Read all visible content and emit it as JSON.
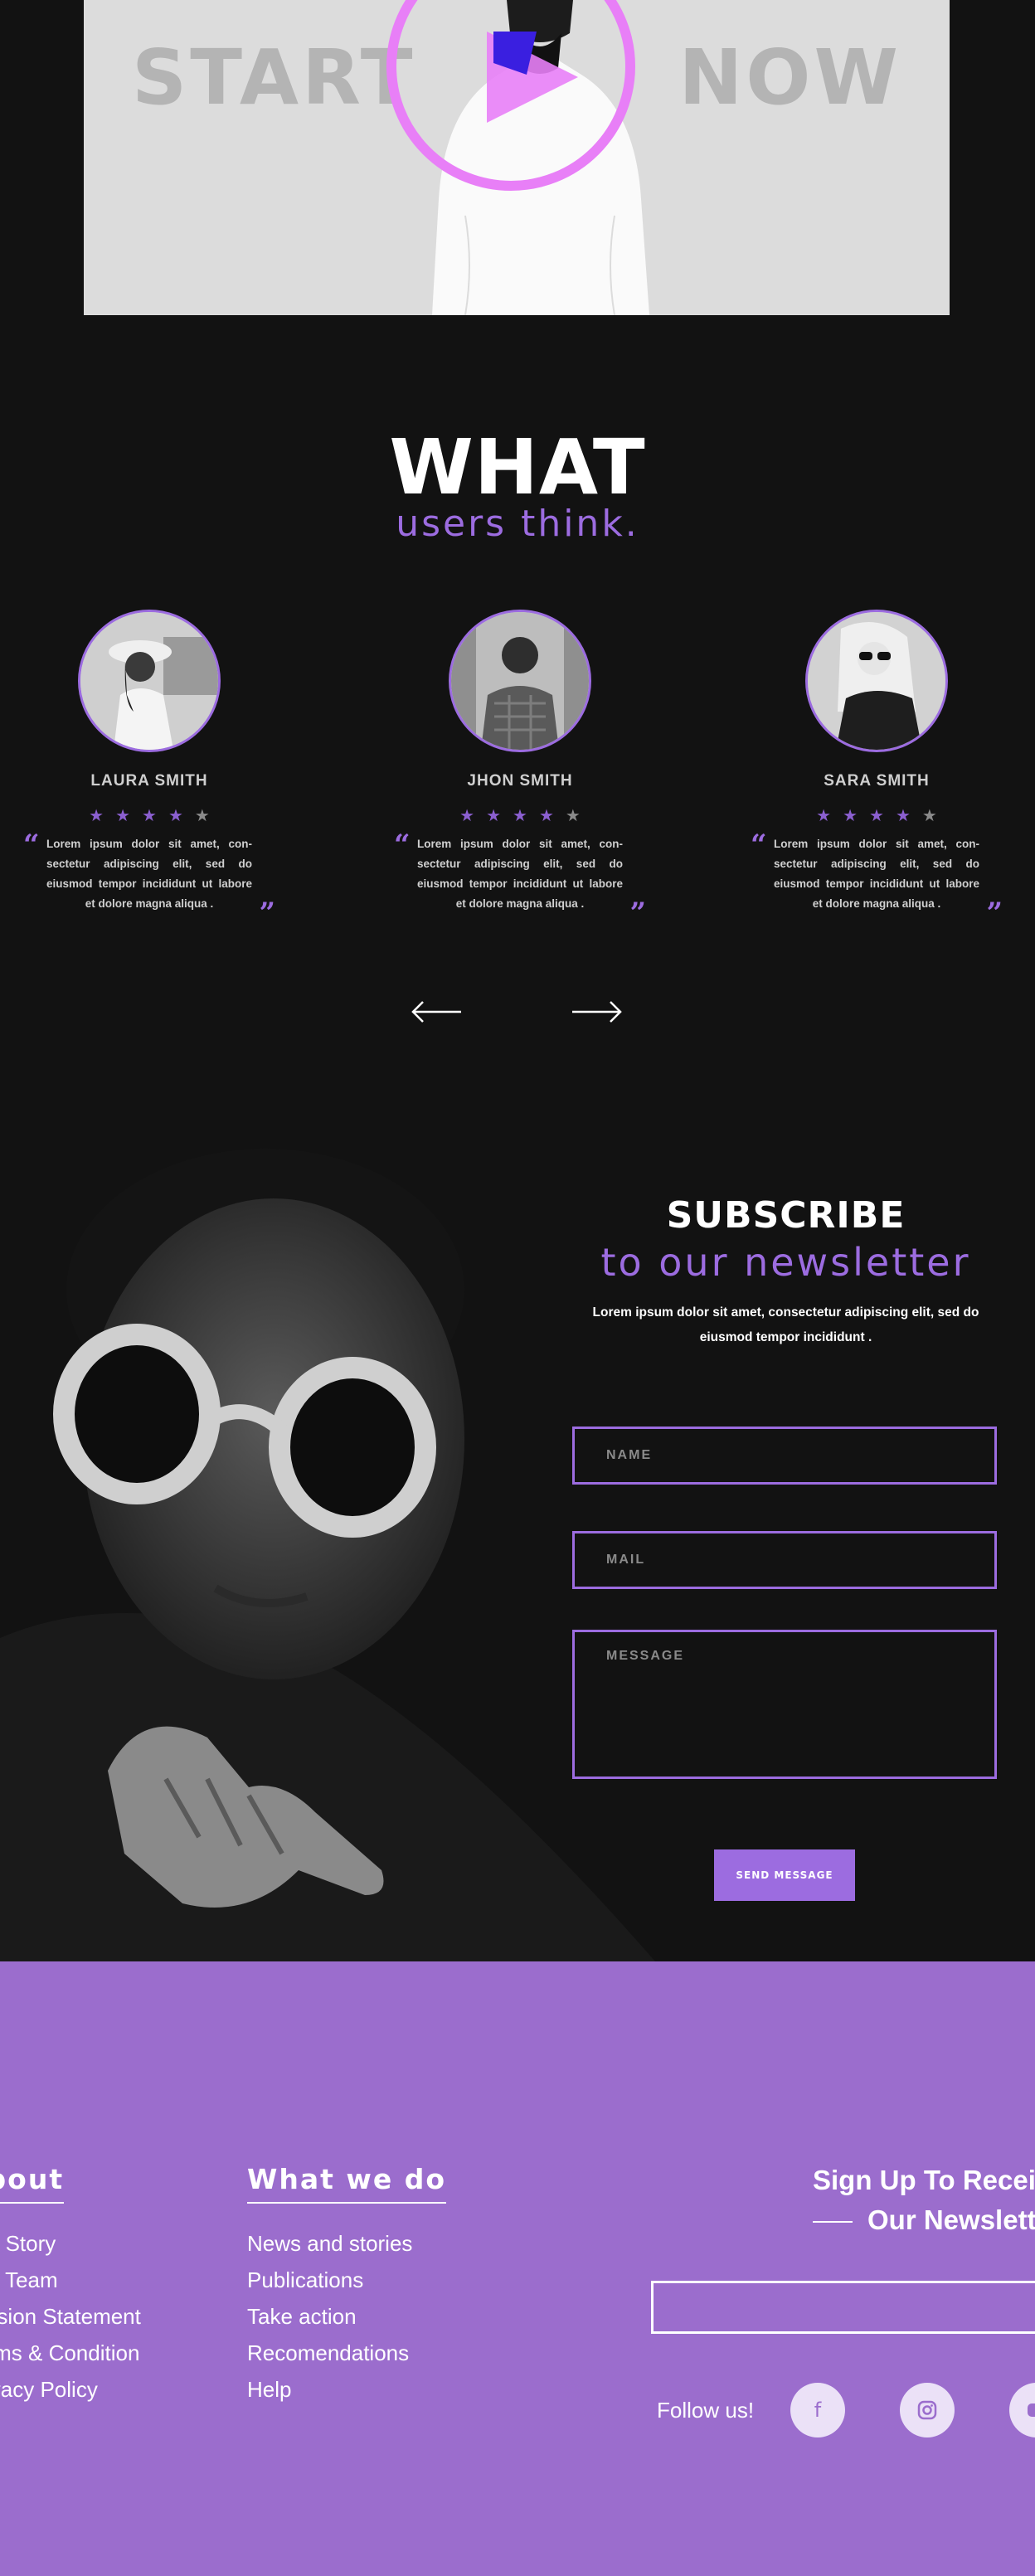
{
  "hero": {
    "left_word": "START",
    "right_word": "NOW",
    "play_icon": "play-icon"
  },
  "testimonials": {
    "title": "WHAT",
    "subtitle": "users think.",
    "cards": [
      {
        "name": "LAURA SMITH",
        "rating": 4,
        "max_rating": 5,
        "quote": "Lorem ipsum dolor sit amet, con-sectetur adipiscing elit, sed do eiusmod tempor incididunt ut labore et dolore magna aliqua ."
      },
      {
        "name": "JHON  SMITH",
        "rating": 4,
        "max_rating": 5,
        "quote": "Lorem ipsum dolor sit amet, con-sectetur adipiscing elit, sed do eiusmod tempor incididunt ut labore et dolore magna aliqua ."
      },
      {
        "name": "SARA  SMITH",
        "rating": 4,
        "max_rating": 5,
        "quote": "Lorem ipsum dolor sit amet, con-sectetur adipiscing elit, sed do eiusmod tempor incididunt ut labore et dolore magna aliqua ."
      }
    ],
    "prev_icon": "arrow-left-icon",
    "next_icon": "arrow-right-icon"
  },
  "subscribe": {
    "title": "SUBSCRIBE",
    "subtitle": "to our newsletter",
    "text": "Lorem ipsum dolor sit amet, consectetur adipiscing elit, sed do eiusmod tempor incididunt .",
    "name_placeholder": "NAME",
    "mail_placeholder": "MAIL",
    "message_placeholder": "MESSAGE",
    "send_label": "SEND MESSAGE"
  },
  "footer": {
    "about_title": "About",
    "about_links": [
      "Our Story",
      "Our Team",
      "Mission Statement",
      "Terms & Condition",
      "Privacy Policy"
    ],
    "whatwedo_title": "What we do",
    "whatwedo_links": [
      "News and stories",
      "Publications",
      "Take action",
      "Recomendations",
      "Help"
    ],
    "newsletter_title_line1": "Sign Up To Receive",
    "newsletter_title_line2": "Our Newsletter",
    "follow_label": "Follow us!",
    "social_icons": [
      "facebook-icon",
      "instagram-icon",
      "youtube-icon"
    ]
  },
  "colors": {
    "accent": "#9c6ce0",
    "pink": "#e87ff7",
    "footer_bg": "#9b6dcd",
    "page_bg": "#121212"
  }
}
